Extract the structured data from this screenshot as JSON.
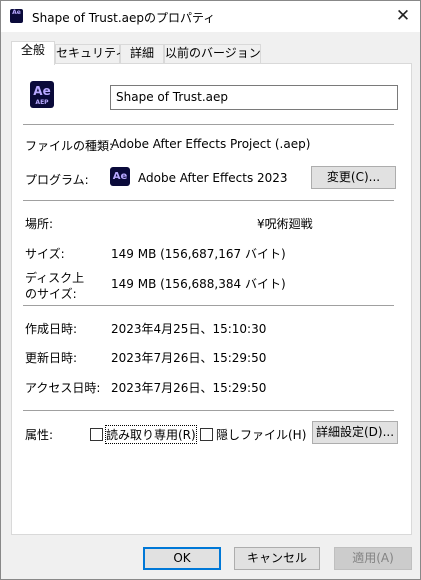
{
  "window": {
    "title": "Shape of Trust.aepのプロパティ",
    "title_icon_text": "Ae",
    "close_glyph": "✕"
  },
  "tabs": [
    {
      "label": "全般"
    },
    {
      "label": "セキュリティ"
    },
    {
      "label": "詳細"
    },
    {
      "label": "以前のバージョン"
    }
  ],
  "file": {
    "icon_text": "Ae",
    "icon_subtext": "AEP",
    "name": "Shape of Trust.aep"
  },
  "type_row": {
    "label": "ファイルの種類:",
    "value": "Adobe After Effects Project (.aep)"
  },
  "program_row": {
    "label": "プログラム:",
    "icon_text": "Ae",
    "value": "Adobe After Effects 2023",
    "change_button": "変更(C)..."
  },
  "location_row": {
    "label": "場所:",
    "value": "¥呪術廻戦"
  },
  "size_row": {
    "label": "サイズ:",
    "value": "149 MB (156,687,167 バイト)"
  },
  "disk_size_row": {
    "label_line1": "ディスク上",
    "label_line2": "のサイズ:",
    "value": "149 MB (156,688,384 バイト)"
  },
  "created_row": {
    "label": "作成日時:",
    "value": "2023年4月25日、15:10:30"
  },
  "modified_row": {
    "label": "更新日時:",
    "value": "2023年7月26日、15:29:50"
  },
  "accessed_row": {
    "label": "アクセス日時:",
    "value": "2023年7月26日、15:29:50"
  },
  "attributes": {
    "label": "属性:",
    "readonly_label": "読み取り専用(R)",
    "hidden_label": "隠しファイル(H)",
    "advanced_button": "詳細設定(D)..."
  },
  "footer": {
    "ok": "OK",
    "cancel": "キャンセル",
    "apply": "適用(A)"
  }
}
